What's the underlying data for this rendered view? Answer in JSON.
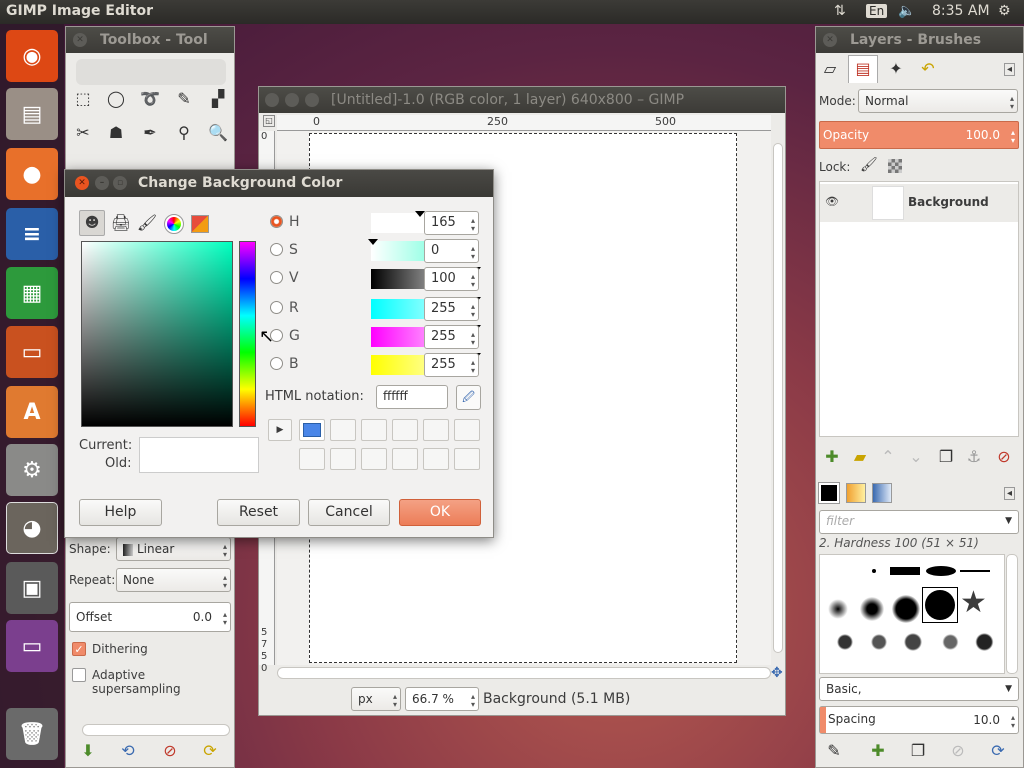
{
  "topbar": {
    "app_title": "GIMP Image Editor",
    "lang": "En",
    "time": "8:35 AM",
    "icons": [
      "network-updown-icon",
      "keyboard-lang-icon",
      "volume-icon",
      "gear-icon"
    ]
  },
  "launcher": {
    "items": [
      "ubuntu-dash",
      "files",
      "firefox",
      "writer",
      "calc",
      "impress",
      "software-center",
      "system-settings",
      "gimp",
      "save-disk",
      "workspace",
      "trash"
    ]
  },
  "toolbox": {
    "title": "Toolbox - Tool",
    "shape_label": "Shape:",
    "shape_value": "Linear",
    "repeat_label": "Repeat:",
    "repeat_value": "None",
    "offset_label": "Offset",
    "offset_value": "0.0",
    "dithering_label": "Dithering",
    "dithering_checked": true,
    "adaptive_label": "Adaptive supersampling",
    "adaptive_checked": false
  },
  "image_window": {
    "title": "[Untitled]-1.0 (RGB color, 1 layer) 640x800 – GIMP",
    "ruler_ticks": [
      "0",
      "250",
      "500"
    ],
    "vruler_ticks": [
      "0",
      "5",
      "7",
      "5",
      "0"
    ],
    "unit": "px",
    "zoom": "66.7 %",
    "status": "Background (5.1 MB)"
  },
  "dialog": {
    "title": "Change Background Color",
    "channels": [
      {
        "label": "H",
        "value": "165",
        "selected": true
      },
      {
        "label": "S",
        "value": "0",
        "selected": false
      },
      {
        "label": "V",
        "value": "100",
        "selected": false
      },
      {
        "label": "R",
        "value": "255",
        "selected": false
      },
      {
        "label": "G",
        "value": "255",
        "selected": false
      },
      {
        "label": "B",
        "value": "255",
        "selected": false
      }
    ],
    "html_label": "HTML notation:",
    "html_value": "ffffff",
    "current_label": "Current:",
    "old_label": "Old:",
    "help": "Help",
    "reset": "Reset",
    "cancel": "Cancel",
    "ok": "OK",
    "colors": {
      "accent": "#e95420",
      "ok_bg": "#f08b6a",
      "history_first": "#4a86e8"
    }
  },
  "layers": {
    "title": "Layers - Brushes",
    "mode_label": "Mode:",
    "mode_value": "Normal",
    "opacity_label": "Opacity",
    "opacity_value": "100.0",
    "lock_label": "Lock:",
    "layer_name": "Background"
  },
  "brushes": {
    "filter_placeholder": "filter",
    "brush_name": "2. Hardness 100 (51 × 51)",
    "preset": "Basic,",
    "spacing_label": "Spacing",
    "spacing_value": "10.0"
  }
}
